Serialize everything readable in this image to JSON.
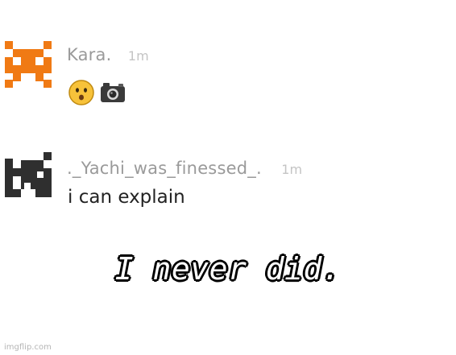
{
  "comments": [
    {
      "username": "Kara.",
      "time": "1m",
      "avatar_icon": "orange-pixel-avatar",
      "avatar_color": "#f07a14",
      "message_emoji": [
        "hushed-face-emoji",
        "camera-emoji"
      ]
    },
    {
      "username": "._Yachi_was_finessed_.",
      "time": "1m",
      "avatar_icon": "dark-pixel-avatar",
      "avatar_color": "#2f2f2f",
      "message": "i can explain"
    }
  ],
  "caption": "I never did.",
  "watermark": "imgflip.com"
}
